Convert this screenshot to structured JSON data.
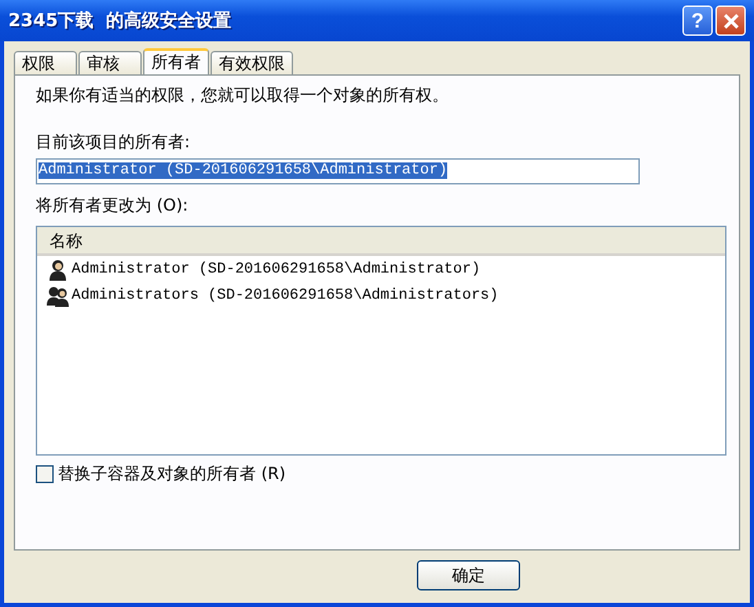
{
  "window": {
    "title": "2345下载  的高级安全设置",
    "help": "?"
  },
  "tabs": [
    {
      "label": "权限",
      "selected": false
    },
    {
      "label": "审核",
      "selected": false
    },
    {
      "label": "所有者",
      "selected": true
    },
    {
      "label": "有效权限",
      "selected": false
    }
  ],
  "intro": "如果你有适当的权限，您就可以取得一个对象的所有权。",
  "current_owner": {
    "label": "目前该项目的所有者:",
    "value": "Administrator (SD-201606291658\\Administrator)"
  },
  "change_to": {
    "label": "将所有者更改为 (O):",
    "columns": [
      "名称"
    ],
    "rows": [
      {
        "kind": "user",
        "name": "Administrator (SD-201606291658\\Administrator)",
        "selected": false
      },
      {
        "kind": "group",
        "name": "Administrators (SD-201606291658\\Administrators)",
        "selected": false
      }
    ]
  },
  "replace_checkbox": {
    "label": "替换子容器及对象的所有者 (R)",
    "checked": false
  },
  "buttons": [
    "确定"
  ]
}
